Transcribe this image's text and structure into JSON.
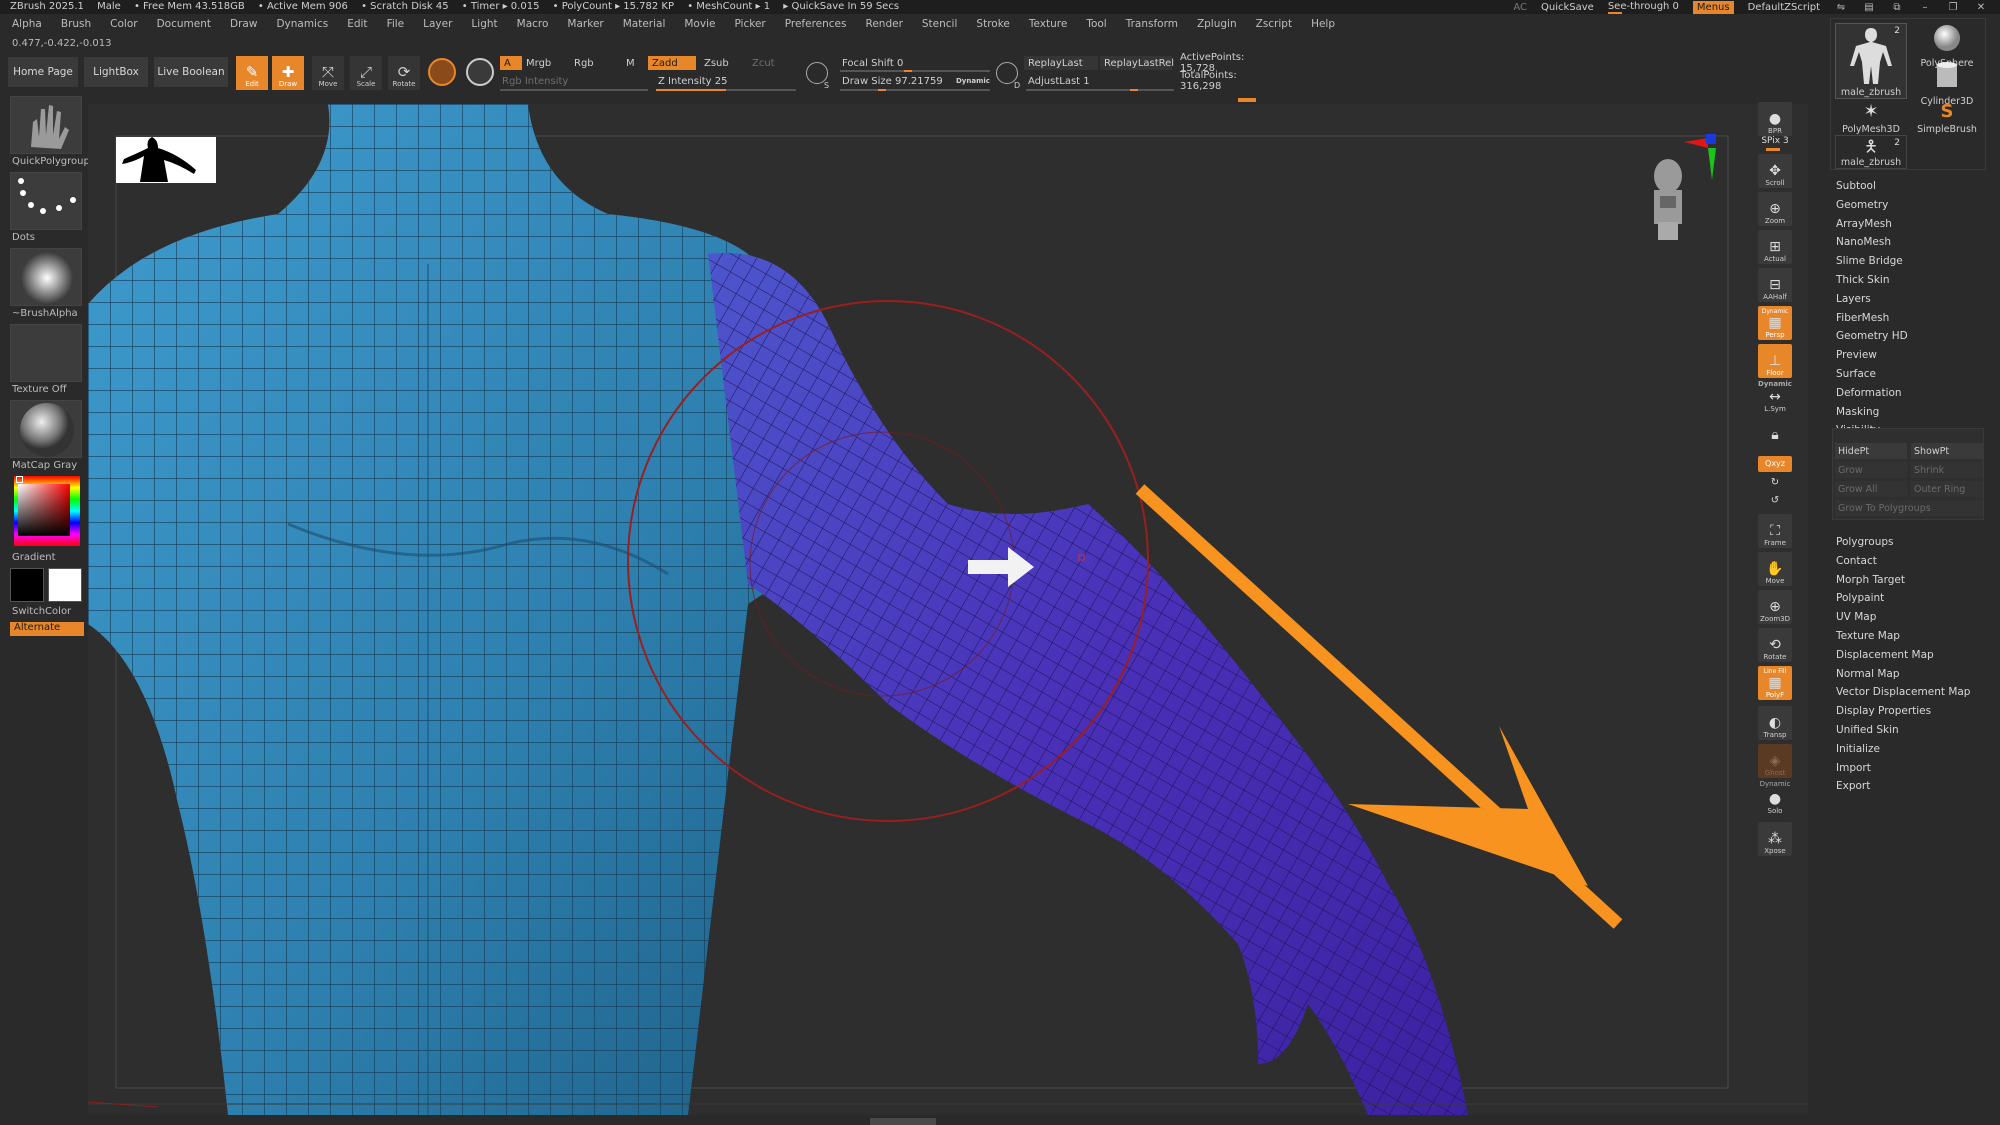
{
  "titlebar": {
    "app": "ZBrush 2025.1",
    "model": "Male",
    "free_mem": "• Free Mem 43.518GB",
    "active_mem": "• Active Mem 906",
    "scratch": "• Scratch Disk 45",
    "timer": "• Timer ▸ 0.015",
    "polycount": "• PolyCount ▸ 15.782 KP",
    "meshcount": "• MeshCount ▸ 1",
    "quicksave": "▸ QuickSave In 59 Secs",
    "ac": "AC",
    "quicksave_btn": "QuickSave",
    "see_through": "See-through  0",
    "menus": "Menus",
    "default_zscript": "DefaultZScript"
  },
  "menubar": [
    "Alpha",
    "Brush",
    "Color",
    "Document",
    "Draw",
    "Dynamics",
    "Edit",
    "File",
    "Layer",
    "Light",
    "Macro",
    "Marker",
    "Material",
    "Movie",
    "Picker",
    "Preferences",
    "Render",
    "Stencil",
    "Stroke",
    "Texture",
    "Tool",
    "Transform",
    "Zplugin",
    "Zscript",
    "Help"
  ],
  "coords": "0.477,-0.422,-0.013",
  "shelf": {
    "home_page": "Home Page",
    "lightbox": "LightBox",
    "live_boolean": "Live Boolean",
    "edit": "Edit",
    "draw": "Draw",
    "move": "Move",
    "scale": "Scale",
    "rotate": "Rotate",
    "a": "A",
    "mrgb": "Mrgb",
    "rgb": "Rgb",
    "m": "M",
    "rgb_intensity": "Rgb Intensity",
    "zadd": "Zadd",
    "zsub": "Zsub",
    "zcut": "Zcut",
    "z_intensity": "Z Intensity 25",
    "focal_shift": "Focal Shift 0",
    "draw_size": "Draw Size 97.21759",
    "dynamic": "Dynamic",
    "s": "S",
    "d": "D",
    "replay_last": "ReplayLast",
    "replay_last_rel": "ReplayLastRel",
    "adjust_last": "AdjustLast 1",
    "active_points": "ActivePoints: 15,728",
    "total_points": "TotalPoints: 316,298"
  },
  "left": {
    "brush": "QuickPolygroup",
    "stroke": "Dots",
    "alpha": "~BrushAlpha",
    "texture": "Texture Off",
    "material": "MatCap Gray",
    "gradient": "Gradient",
    "switch_color": "SwitchColor",
    "alternate": "Alternate"
  },
  "right_strip": {
    "bpr": "BPR",
    "spix": "SPix 3",
    "scroll": "Scroll",
    "zoom": "Zoom",
    "actual": "Actual",
    "aahalf": "AAHalf",
    "dynamic_persp": "Dynamic",
    "persp": "Persp",
    "floor": "Floor",
    "dynamic2": "Dynamic",
    "lsym": "L.Sym",
    "xyz": "Qxyz",
    "frame": "Frame",
    "move": "Move",
    "zoom3d": "Zoom3D",
    "rotate": "Rotate",
    "linefill": "Line Fill",
    "polyf": "PolyF",
    "transp": "Transp",
    "ghost": "Ghost",
    "dynamic3": "Dynamic",
    "solo": "Solo",
    "xpose": "Xpose"
  },
  "tool_palette": {
    "t1": "male_zbrush",
    "t1_count": "2",
    "t2": "PolySphere",
    "t3": "PolyMesh3D",
    "t4": "Cylinder3D",
    "t5": "SimpleBrush",
    "t6": "male_zbrush",
    "t6_count": "2"
  },
  "subpalette": [
    "Subtool",
    "Geometry",
    "ArrayMesh",
    "NanoMesh",
    "Slime Bridge",
    "Thick Skin",
    "Layers",
    "FiberMesh",
    "Geometry HD",
    "Preview",
    "Surface",
    "Deformation",
    "Masking",
    "Visibility"
  ],
  "visibility": {
    "hidept": "HidePt",
    "showpt": "ShowPt",
    "grow": "Grow",
    "shrink": "Shrink",
    "grow_all": "Grow All",
    "outer_ring": "Outer Ring",
    "grow_to_polygroups": "Grow To Polygroups"
  },
  "subpalette2": [
    "Polygroups",
    "Contact",
    "Morph Target",
    "Polypaint",
    "UV Map",
    "Texture Map",
    "Displacement Map",
    "Normal Map",
    "Vector Displacement Map",
    "Display Properties",
    "Unified Skin",
    "Initialize",
    "Import",
    "Export"
  ],
  "colors": {
    "accent": "#e8872a",
    "torso": "#2e7fb0",
    "arm": "#4a2fb5",
    "brush_ring": "#9a1f1f"
  }
}
